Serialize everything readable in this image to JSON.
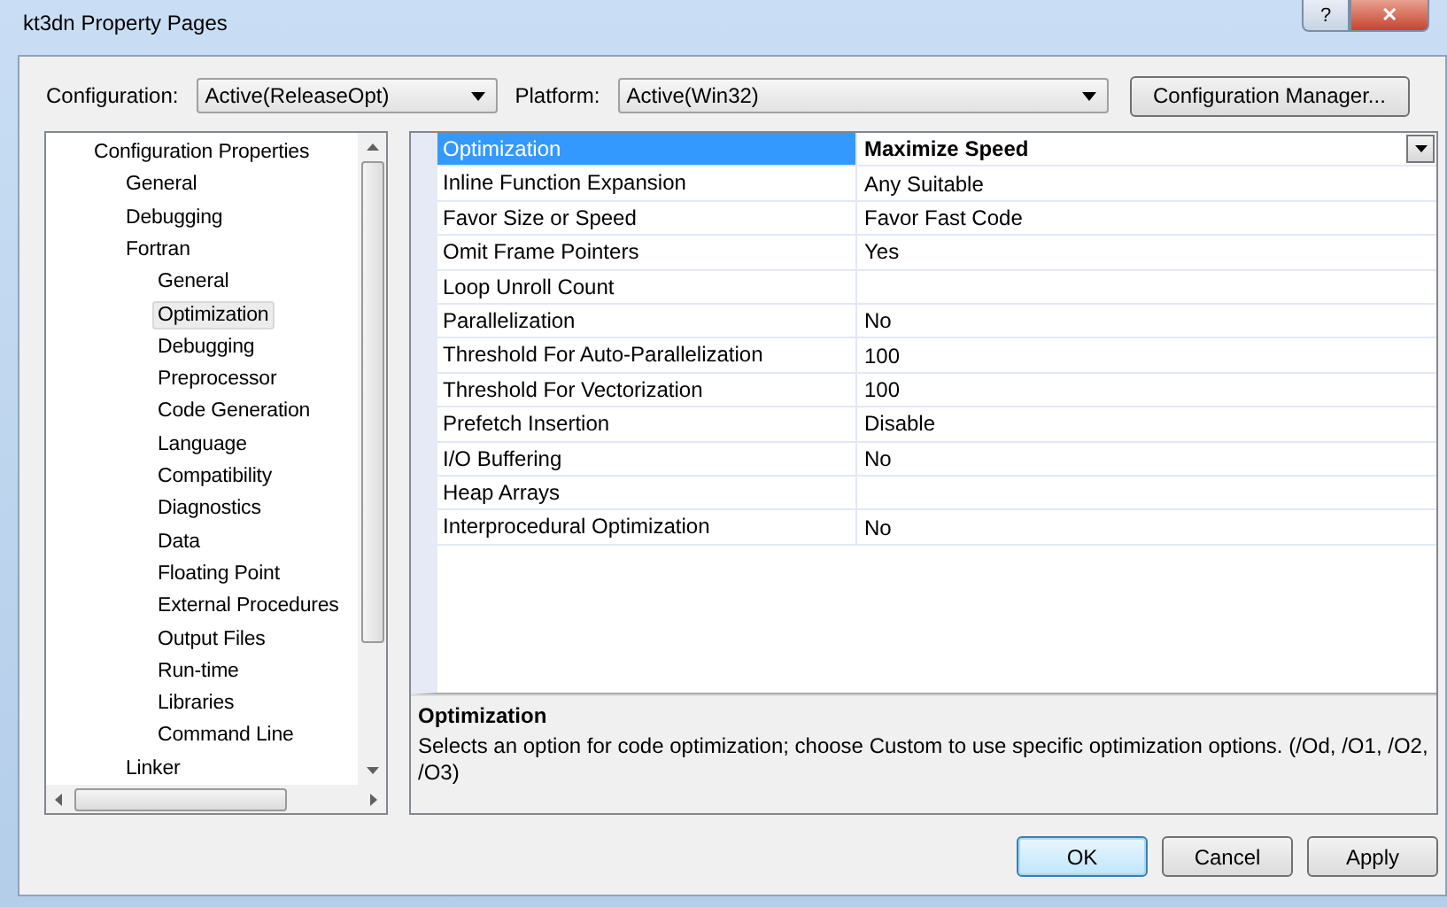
{
  "window": {
    "title": "kt3dn Property Pages",
    "help_button": "?",
    "close_button": "✕"
  },
  "configuration": {
    "label": "Configuration:",
    "value": "Active(ReleaseOpt)"
  },
  "platform": {
    "label": "Platform:",
    "value": "Active(Win32)"
  },
  "manager_button": "Configuration Manager...",
  "tree": [
    {
      "label": "Configuration Properties",
      "selected": false,
      "children": [
        {
          "label": "General",
          "selected": false
        },
        {
          "label": "Debugging",
          "selected": false
        },
        {
          "label": "Fortran",
          "selected": false,
          "children": [
            {
              "label": "General",
              "selected": false
            },
            {
              "label": "Optimization",
              "selected": true
            },
            {
              "label": "Debugging",
              "selected": false
            },
            {
              "label": "Preprocessor",
              "selected": false
            },
            {
              "label": "Code Generation",
              "selected": false
            },
            {
              "label": "Language",
              "selected": false
            },
            {
              "label": "Compatibility",
              "selected": false
            },
            {
              "label": "Diagnostics",
              "selected": false
            },
            {
              "label": "Data",
              "selected": false
            },
            {
              "label": "Floating Point",
              "selected": false
            },
            {
              "label": "External Procedures",
              "selected": false
            },
            {
              "label": "Output Files",
              "selected": false
            },
            {
              "label": "Run-time",
              "selected": false
            },
            {
              "label": "Libraries",
              "selected": false
            },
            {
              "label": "Command Line",
              "selected": false
            }
          ]
        },
        {
          "label": "Linker",
          "selected": false
        }
      ]
    }
  ],
  "properties": [
    {
      "name": "Optimization",
      "value": "Maximize Speed",
      "selected": true
    },
    {
      "name": "Inline Function Expansion",
      "value": "Any Suitable",
      "selected": false
    },
    {
      "name": "Favor Size or Speed",
      "value": "Favor Fast Code",
      "selected": false
    },
    {
      "name": "Omit Frame Pointers",
      "value": "Yes",
      "selected": false
    },
    {
      "name": "Loop Unroll Count",
      "selected": false
    },
    {
      "name": "Parallelization",
      "value": "No",
      "selected": false
    },
    {
      "name": "Threshold For Auto-Parallelization",
      "value": "100",
      "selected": false
    },
    {
      "name": "Threshold For Vectorization",
      "value": "100",
      "selected": false
    },
    {
      "name": "Prefetch Insertion",
      "value": "Disable",
      "selected": false
    },
    {
      "name": "I/O Buffering",
      "value": "No",
      "selected": false
    },
    {
      "name": "Heap Arrays",
      "selected": false
    },
    {
      "name": "Interprocedural Optimization",
      "value": "No",
      "selected": false
    }
  ],
  "description": {
    "title": "Optimization",
    "text": "Selects an option for code optimization; choose Custom to use specific optimization options. (/Od, /O1, /O2, /O3)"
  },
  "buttons": [
    {
      "label": "OK",
      "default": true
    },
    {
      "label": "Cancel",
      "default": false
    },
    {
      "label": "Apply",
      "default": false
    }
  ]
}
